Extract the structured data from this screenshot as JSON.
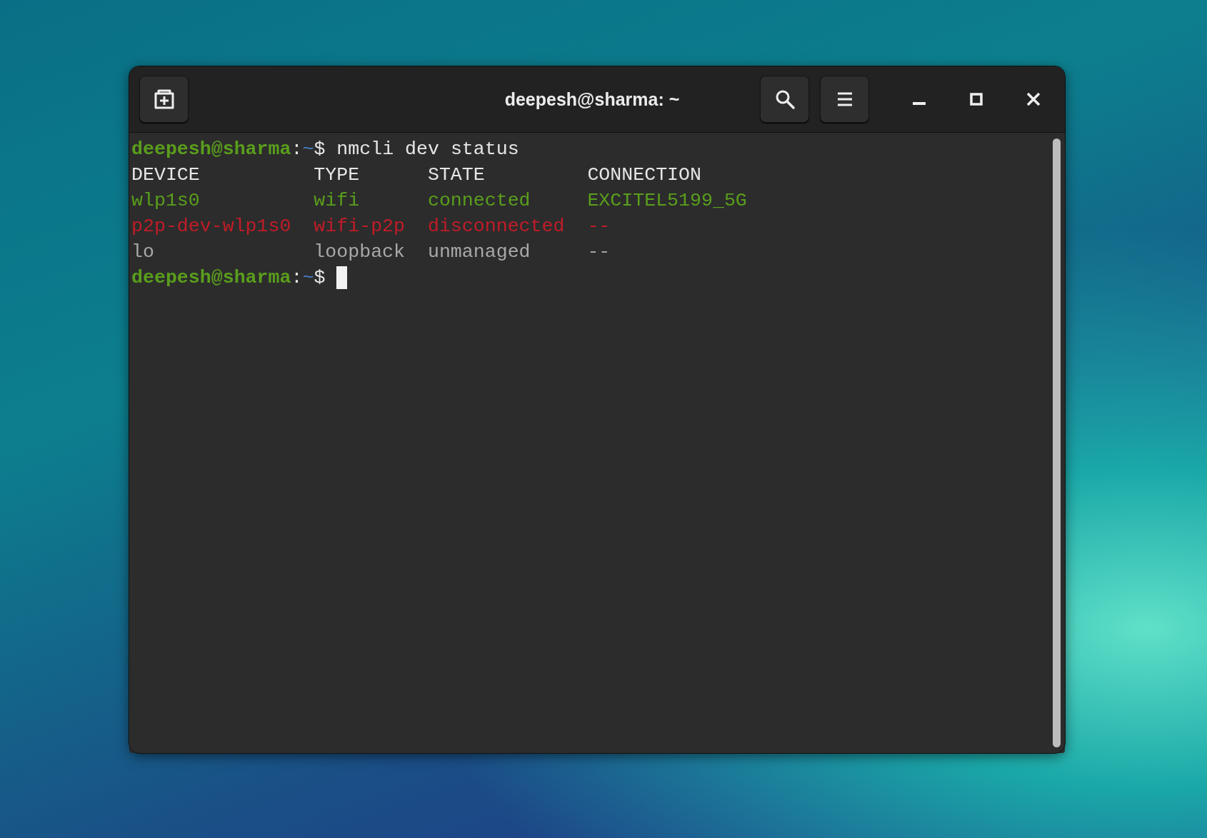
{
  "window": {
    "title": "deepesh@sharma: ~"
  },
  "terminal": {
    "command_prompt": {
      "user_host": "deepesh@sharma",
      "separator": ":",
      "path": "~",
      "symbol": "$"
    },
    "command": "nmcli dev status",
    "current_prompt": {
      "user_host": "deepesh@sharma",
      "separator": ":",
      "path": "~",
      "symbol": "$"
    },
    "columns": [
      "DEVICE",
      "TYPE",
      "STATE",
      "CONNECTION"
    ],
    "rows": [
      {
        "cells": [
          "wlp1s0",
          "wifi",
          "connected",
          "EXCITEL5199_5G"
        ],
        "color": "#5a9e1c"
      },
      {
        "cells": [
          "p2p-dev-wlp1s0",
          "wifi-p2p",
          "disconnected",
          "--"
        ],
        "color": "#c01c28"
      },
      {
        "cells": [
          "lo",
          "loopback",
          "unmanaged",
          "--"
        ],
        "color": "#a8a8a8"
      }
    ]
  }
}
